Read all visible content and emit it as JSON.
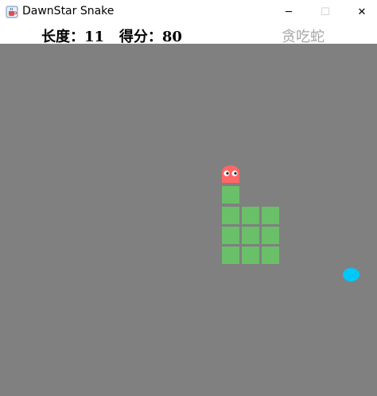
{
  "window": {
    "title": "DawnStar Snake",
    "minimize_glyph": "─",
    "maximize_glyph": "☐",
    "close_glyph": "✕"
  },
  "header": {
    "length_label": "长度：",
    "length_value": "11",
    "score_label": "得分：",
    "score_value": "80",
    "game_title": "贪吃蛇"
  },
  "colors": {
    "board": "#808080",
    "snake_body": "#6abf69",
    "snake_head": "#ff6666",
    "food": "#00c8f8",
    "game_title": "#a6a6a6"
  },
  "icons": {
    "app": "java-coffee-cup-icon",
    "head": "snake-head-with-eyes"
  }
}
